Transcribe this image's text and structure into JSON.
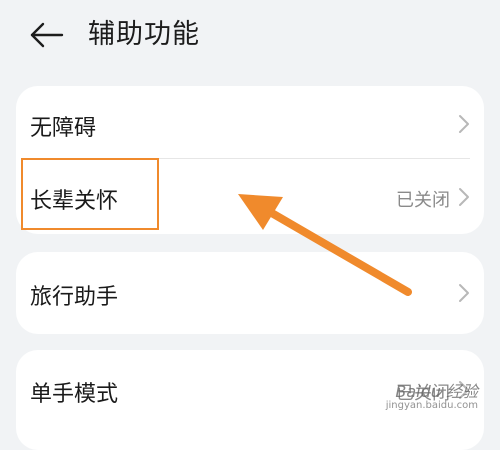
{
  "header": {
    "title": "辅助功能",
    "back_icon": "back-arrow-icon"
  },
  "cards": {
    "card1": {
      "items": [
        {
          "label": "无障碍",
          "status": ""
        },
        {
          "label": "长辈关怀",
          "status": "已关闭"
        }
      ]
    },
    "card2": {
      "items": [
        {
          "label": "旅行助手",
          "status": ""
        }
      ]
    },
    "card3": {
      "items": [
        {
          "label": "单手模式",
          "status": "已关闭"
        }
      ]
    }
  },
  "annotation": {
    "highlight_color": "#f08a2c",
    "arrow_color": "#f08a2c"
  },
  "watermark": {
    "brand": "Baidu 经验",
    "url": "jingyan.baidu.com"
  }
}
